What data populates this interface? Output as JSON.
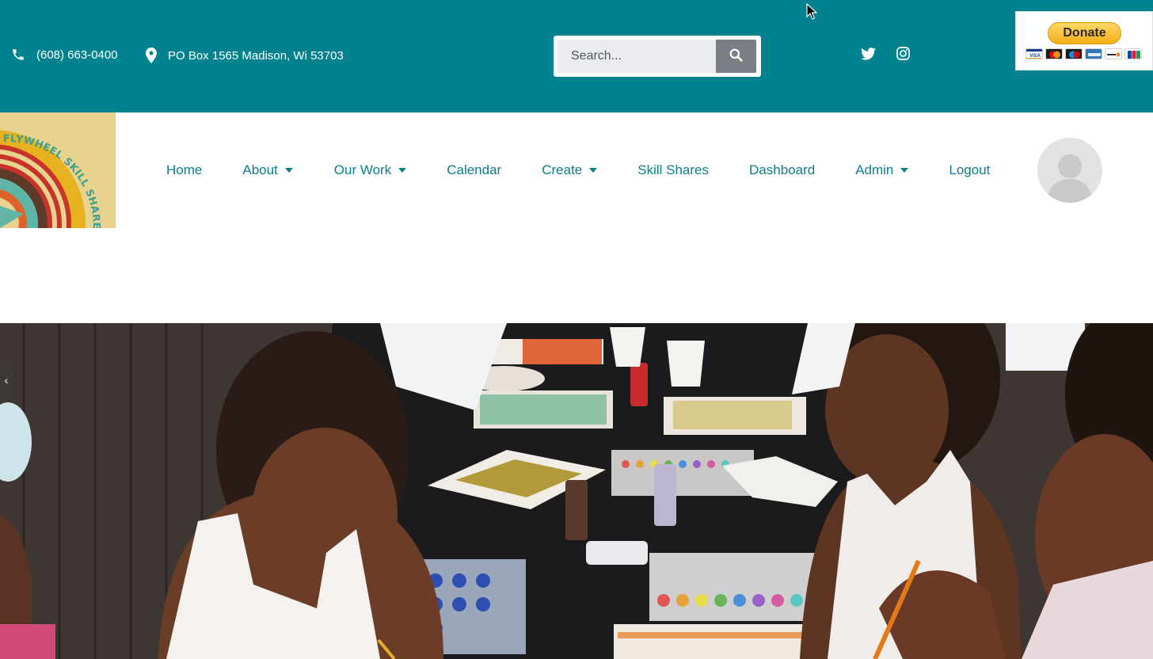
{
  "topbar": {
    "phone": "(608) 663-0400",
    "address": "PO Box 1565 Madison, Wi 53703",
    "social": [
      "twitter-icon",
      "instagram-icon"
    ]
  },
  "search": {
    "placeholder": "Search...",
    "button_icon": "search-icon"
  },
  "donate": {
    "label": "Donate",
    "cards": [
      "visa",
      "mastercard",
      "maestro",
      "amex",
      "discover",
      "jcb"
    ]
  },
  "logo": {
    "text": "FLYWHEEL SKILL SHARE"
  },
  "nav": {
    "items": [
      {
        "label": "Home",
        "dropdown": false
      },
      {
        "label": "About",
        "dropdown": true
      },
      {
        "label": "Our Work",
        "dropdown": true
      },
      {
        "label": "Calendar",
        "dropdown": false
      },
      {
        "label": "Create",
        "dropdown": true
      },
      {
        "label": "Skill Shares",
        "dropdown": false
      },
      {
        "label": "Dashboard",
        "dropdown": false
      },
      {
        "label": "Admin",
        "dropdown": true
      },
      {
        "label": "Logout",
        "dropdown": false
      }
    ]
  },
  "hero": {
    "slider_prev": "‹"
  },
  "colors": {
    "topbar": "#00838f",
    "nav_text": "#0c7e8c",
    "logo_bg": "#e7d38e"
  }
}
